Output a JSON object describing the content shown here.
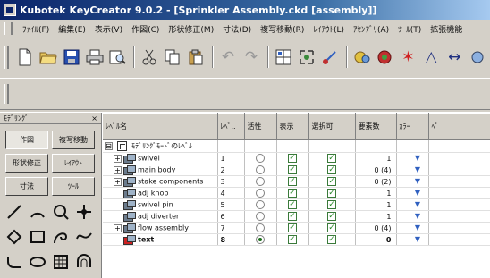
{
  "window": {
    "title": "Kubotek KeyCreator 9.0.2 - [Sprinkler Assembly.ckd [assembly]]"
  },
  "menubar": {
    "items": [
      {
        "label": "ﾌｧｲﾙ(F)"
      },
      {
        "label": "編集(E)"
      },
      {
        "label": "表示(V)"
      },
      {
        "label": "作図(C)"
      },
      {
        "label": "形状修正(M)"
      },
      {
        "label": "寸法(D)"
      },
      {
        "label": "複写移動(R)"
      },
      {
        "label": "ﾚｲｱｳﾄ(L)"
      },
      {
        "label": "ｱｾﾝﾌﾞﾘ(A)"
      },
      {
        "label": "ﾂｰﾙ(T)"
      },
      {
        "label": "拡張機能"
      }
    ]
  },
  "toolbar": {
    "icons": [
      "new-file-icon",
      "open-file-icon",
      "save-icon",
      "print-icon",
      "print-preview-icon",
      "cut-icon",
      "copy-icon",
      "paste-icon",
      "undo-icon",
      "redo-icon",
      "window-zoom-icon",
      "fit-view-icon",
      "pan-icon",
      "display-icon",
      "render-icon",
      "star-icon",
      "triangle-icon",
      "measure-icon",
      "more-icon"
    ]
  },
  "leftpanel": {
    "header": "ﾓﾃﾞﾘﾝｸﾞ",
    "close": "×",
    "buttons": [
      {
        "label": "作図"
      },
      {
        "label": "複写移動"
      },
      {
        "label": "形状修正"
      },
      {
        "label": "ﾚｲｱｳﾄ"
      },
      {
        "label": "寸法"
      },
      {
        "label": "ﾂｰﾙ"
      }
    ]
  },
  "table": {
    "columns": [
      "ﾚﾍﾞﾙ名",
      "ﾚﾍﾞ..",
      "活性",
      "表示",
      "選択可",
      "要素数",
      "ｶﾗｰ",
      "ﾍﾟ"
    ],
    "root": {
      "name": "ﾓﾃﾞﾘﾝｸﾞﾓｰﾄﾞのﾚﾍﾞﾙ",
      "expander": "⊟"
    },
    "rows": [
      {
        "name": "swivel",
        "level": "1",
        "active": false,
        "show": true,
        "select": true,
        "count": "1",
        "expander": "+",
        "bold": false
      },
      {
        "name": "main body",
        "level": "2",
        "active": false,
        "show": true,
        "select": true,
        "count": "0 (4)",
        "expander": "+",
        "bold": false
      },
      {
        "name": "stake components",
        "level": "3",
        "active": false,
        "show": true,
        "select": true,
        "count": "0 (2)",
        "expander": "+",
        "bold": false
      },
      {
        "name": "adj knob",
        "level": "4",
        "active": false,
        "show": true,
        "select": true,
        "count": "1",
        "expander": "",
        "bold": false
      },
      {
        "name": "swivel pin",
        "level": "5",
        "active": false,
        "show": true,
        "select": true,
        "count": "1",
        "expander": "",
        "bold": false
      },
      {
        "name": "adj diverter",
        "level": "6",
        "active": false,
        "show": true,
        "select": true,
        "count": "1",
        "expander": "",
        "bold": false
      },
      {
        "name": "flow assembly",
        "level": "7",
        "active": false,
        "show": true,
        "select": true,
        "count": "0 (4)",
        "expander": "+",
        "bold": false
      },
      {
        "name": "text",
        "level": "8",
        "active": true,
        "show": true,
        "select": true,
        "count": "0",
        "expander": "",
        "bold": true
      }
    ]
  },
  "colors": {
    "titlebar_start": "#0a246a",
    "titlebar_end": "#a6caf0",
    "chrome": "#d4d0c8",
    "check_green": "#2a8a2a"
  }
}
